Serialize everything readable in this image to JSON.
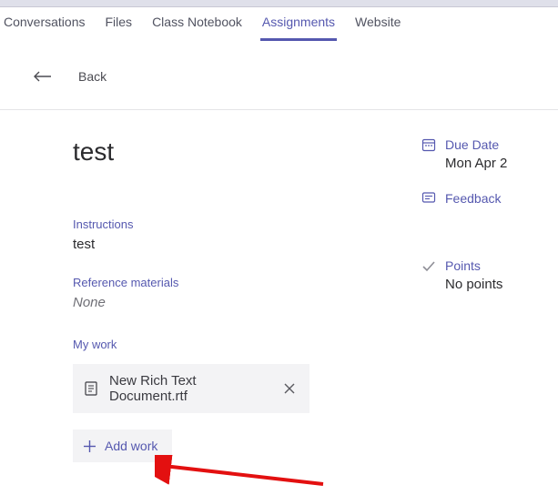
{
  "tabs": {
    "items": [
      {
        "label": "Conversations",
        "active": false
      },
      {
        "label": "Files",
        "active": false
      },
      {
        "label": "Class Notebook",
        "active": false
      },
      {
        "label": "Assignments",
        "active": true
      },
      {
        "label": "Website",
        "active": false
      }
    ]
  },
  "back": {
    "label": "Back"
  },
  "assignment": {
    "title": "test",
    "instructions_label": "Instructions",
    "instructions_text": "test",
    "reference_label": "Reference materials",
    "reference_text": "None",
    "mywork_label": "My work",
    "file_name": "New Rich Text Document.rtf",
    "add_work_label": "Add work"
  },
  "sidebar": {
    "due_label": "Due Date",
    "due_value": "Mon Apr 2",
    "feedback_label": "Feedback",
    "points_label": "Points",
    "points_value": "No points"
  }
}
